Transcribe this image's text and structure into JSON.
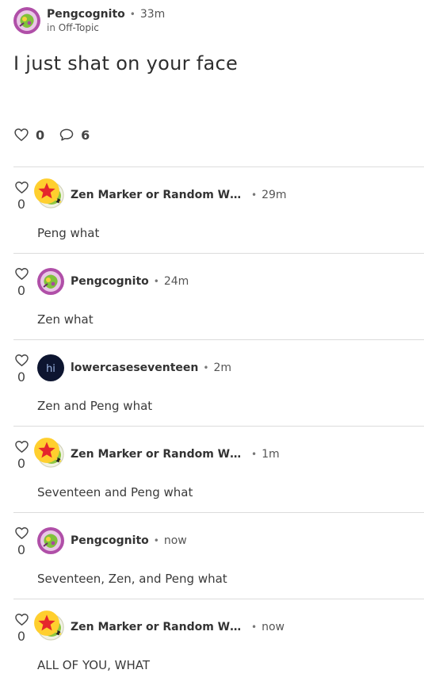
{
  "post": {
    "author": "Pengcognito",
    "time": "33m",
    "in_prefix": "in",
    "category": "Off-Topic",
    "title": "I just shat on your face",
    "likes": "0",
    "comments_count": "6"
  },
  "colors": {
    "divider": "#dcdcdc",
    "text": "#3a3a3a"
  },
  "comments": [
    {
      "author": "Zen Marker or Random Whipp…",
      "time": "29m",
      "text": "Peng what",
      "likes": "0",
      "avatar": "zen-avatar",
      "badge": "star-badge-icon"
    },
    {
      "author": "Pengcognito",
      "time": "24m",
      "text": "Zen what",
      "likes": "0",
      "avatar": "peng-avatar"
    },
    {
      "author": "lowercaseseventeen",
      "time": "2m",
      "text": "Zen and Peng what",
      "likes": "0",
      "avatar": "hi-avatar"
    },
    {
      "author": "Zen Marker or Random Whipp…",
      "time": "1m",
      "text": "Seventeen and Peng what",
      "likes": "0",
      "avatar": "zen-avatar",
      "badge": "star-badge-icon"
    },
    {
      "author": "Pengcognito",
      "time": "now",
      "text": "Seventeen, Zen, and Peng what",
      "likes": "0",
      "avatar": "peng-avatar"
    },
    {
      "author": "Zen Marker or Random Whipp…",
      "time": "now",
      "text": "ALL OF YOU, WHAT",
      "likes": "0",
      "avatar": "zen-avatar",
      "badge": "star-badge-icon"
    }
  ]
}
